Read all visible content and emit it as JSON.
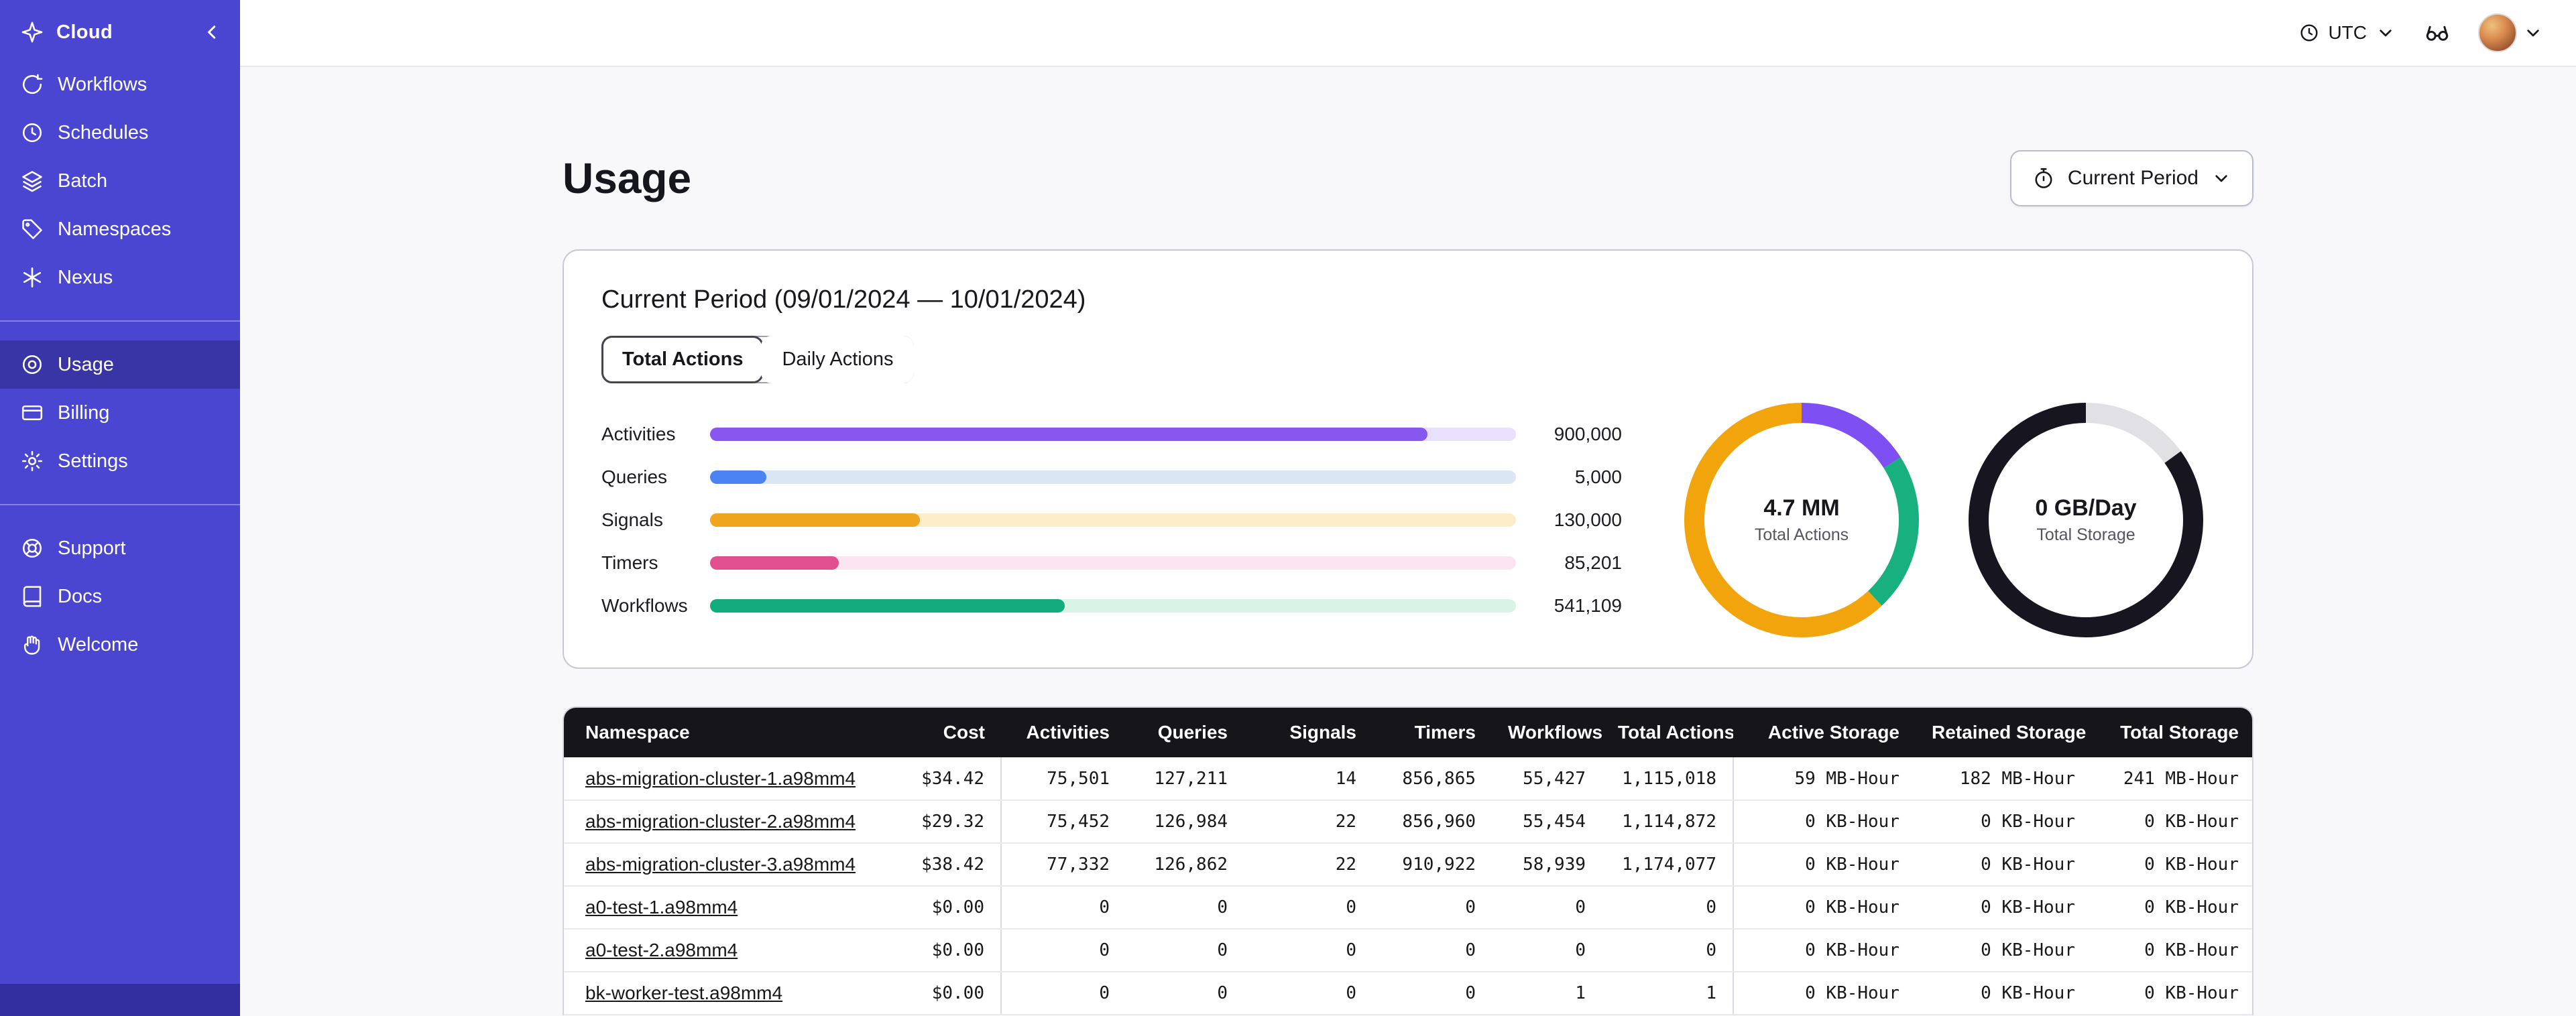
{
  "topbar": {
    "timezone": "UTC"
  },
  "sidebar": {
    "title": "Cloud",
    "groups": [
      [
        {
          "label": "Workflows",
          "icon": "workflows-icon"
        },
        {
          "label": "Schedules",
          "icon": "schedules-icon"
        },
        {
          "label": "Batch",
          "icon": "batch-icon"
        },
        {
          "label": "Namespaces",
          "icon": "namespaces-icon"
        },
        {
          "label": "Nexus",
          "icon": "nexus-icon"
        }
      ],
      [
        {
          "label": "Usage",
          "icon": "usage-icon",
          "active": true
        },
        {
          "label": "Billing",
          "icon": "billing-icon"
        },
        {
          "label": "Settings",
          "icon": "settings-icon"
        }
      ],
      [
        {
          "label": "Support",
          "icon": "support-icon"
        },
        {
          "label": "Docs",
          "icon": "docs-icon"
        },
        {
          "label": "Welcome",
          "icon": "hand-wave-icon"
        }
      ]
    ]
  },
  "page": {
    "title": "Usage",
    "period_selector": "Current Period",
    "card_title": "Current Period (09/01/2024 — 10/01/2024)",
    "tabs": [
      {
        "label": "Total Actions",
        "active": true
      },
      {
        "label": "Daily Actions",
        "active": false
      }
    ]
  },
  "chart_data": [
    {
      "type": "bar",
      "orientation": "horizontal",
      "title": "Current Period (09/01/2024 — 10/01/2024)",
      "categories": [
        "Activities",
        "Queries",
        "Signals",
        "Timers",
        "Workflows"
      ],
      "values": [
        900000,
        5000,
        130000,
        85201,
        541109
      ],
      "value_labels": [
        "900,000",
        "5,000",
        "130,000",
        "85,201",
        "541,109"
      ],
      "bar_colors": [
        "#8757f0",
        "#4b82f4",
        "#f0a51e",
        "#e0508f",
        "#12ac7c"
      ],
      "track_colors": [
        "#e9e1fc",
        "#dbe6f5",
        "#fdeec9",
        "#fce4f1",
        "#d9f3e5"
      ],
      "fill_pct": [
        89,
        7,
        26,
        16,
        44
      ],
      "legend": "none",
      "grid": false
    },
    {
      "type": "donut",
      "center_value": "4.7 MM",
      "center_label": "Total Actions",
      "segments": [
        {
          "name": "purple",
          "color": "#7e4ff3",
          "pct": 16
        },
        {
          "name": "green",
          "color": "#17b07e",
          "pct": 22
        },
        {
          "name": "orange",
          "color": "#f2a40d",
          "pct": 62
        }
      ]
    },
    {
      "type": "donut",
      "center_value": "0 GB/Day",
      "center_label": "Total Storage",
      "segments": [
        {
          "name": "light-gray",
          "color": "#e0e0e5",
          "pct": 15
        },
        {
          "name": "dark",
          "color": "#17151f",
          "pct": 85
        }
      ]
    }
  ],
  "table": {
    "columns": [
      "Namespace",
      "Cost",
      "Activities",
      "Queries",
      "Signals",
      "Timers",
      "Workflows",
      "Total Actions",
      "Active Storage",
      "Retained Storage",
      "Total Storage"
    ],
    "rows": [
      [
        "abs-migration-cluster-1.a98mm4",
        "$34.42",
        "75,501",
        "127,211",
        "14",
        "856,865",
        "55,427",
        "1,115,018",
        "59 MB-Hour",
        "182 MB-Hour",
        "241 MB-Hour"
      ],
      [
        "abs-migration-cluster-2.a98mm4",
        "$29.32",
        "75,452",
        "126,984",
        "22",
        "856,960",
        "55,454",
        "1,114,872",
        "0 KB-Hour",
        "0 KB-Hour",
        "0 KB-Hour"
      ],
      [
        "abs-migration-cluster-3.a98mm4",
        "$38.42",
        "77,332",
        "126,862",
        "22",
        "910,922",
        "58,939",
        "1,174,077",
        "0 KB-Hour",
        "0 KB-Hour",
        "0 KB-Hour"
      ],
      [
        "a0-test-1.a98mm4",
        "$0.00",
        "0",
        "0",
        "0",
        "0",
        "0",
        "0",
        "0 KB-Hour",
        "0 KB-Hour",
        "0 KB-Hour"
      ],
      [
        "a0-test-2.a98mm4",
        "$0.00",
        "0",
        "0",
        "0",
        "0",
        "0",
        "0",
        "0 KB-Hour",
        "0 KB-Hour",
        "0 KB-Hour"
      ],
      [
        "bk-worker-test.a98mm4",
        "$0.00",
        "0",
        "0",
        "0",
        "0",
        "1",
        "1",
        "0 KB-Hour",
        "0 KB-Hour",
        "0 KB-Hour"
      ]
    ]
  }
}
